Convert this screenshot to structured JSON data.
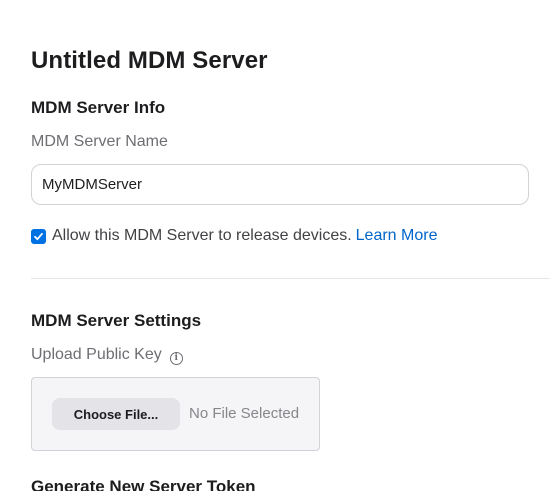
{
  "page": {
    "title": "Untitled MDM Server"
  },
  "server_info": {
    "heading": "MDM Server Info",
    "name_label": "MDM Server Name",
    "name_value": "MyMDMServer",
    "release_checkbox_checked": true,
    "release_checkbox_label": "Allow this MDM Server to release devices.",
    "learn_more_label": "Learn More"
  },
  "server_settings": {
    "heading": "MDM Server Settings",
    "upload_label": "Upload Public Key",
    "upload_info_icon": "info-circle-icon",
    "choose_file_label": "Choose File...",
    "file_status": "No File Selected",
    "token_heading": "Generate New Server Token"
  },
  "colors": {
    "accent": "#0071e3",
    "link": "#0066cc",
    "text": "#1d1d1f",
    "secondary_text": "#6e6e73"
  }
}
